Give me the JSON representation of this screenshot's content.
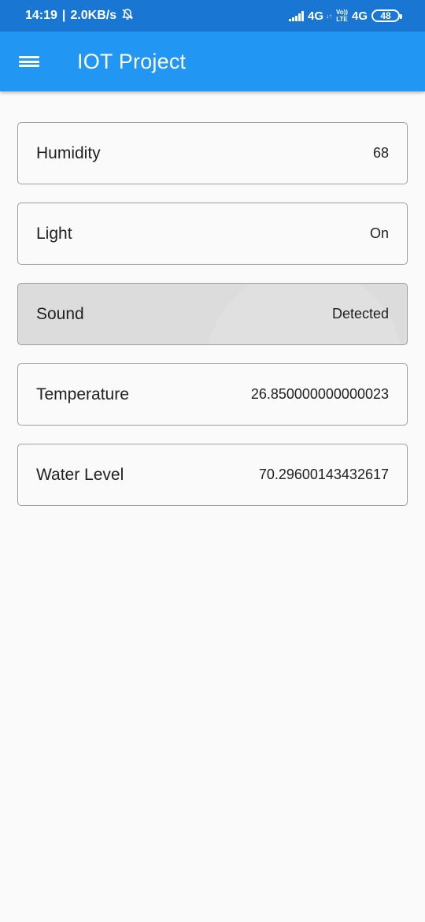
{
  "status_bar": {
    "time": "14:19",
    "separator": "|",
    "speed": "2.0KB/s",
    "network1": "4G",
    "network1_small": "↓↑",
    "volte_top": "Vo))",
    "volte_bottom": "LTE",
    "network2": "4G",
    "battery": "48"
  },
  "app_bar": {
    "title": "IOT Project",
    "menu_icon": "menu-icon"
  },
  "readings": [
    {
      "label": "Humidity",
      "value": "68"
    },
    {
      "label": "Light",
      "value": "On"
    },
    {
      "label": "Sound",
      "value": "Detected"
    },
    {
      "label": "Temperature",
      "value": "26.850000000000023"
    },
    {
      "label": "Water Level",
      "value": "70.29600143432617"
    }
  ],
  "colors": {
    "status_bar": "#1976d2",
    "app_bar": "#2196f3",
    "background": "#fafafa",
    "pressed_card": "#dcdcdc"
  }
}
